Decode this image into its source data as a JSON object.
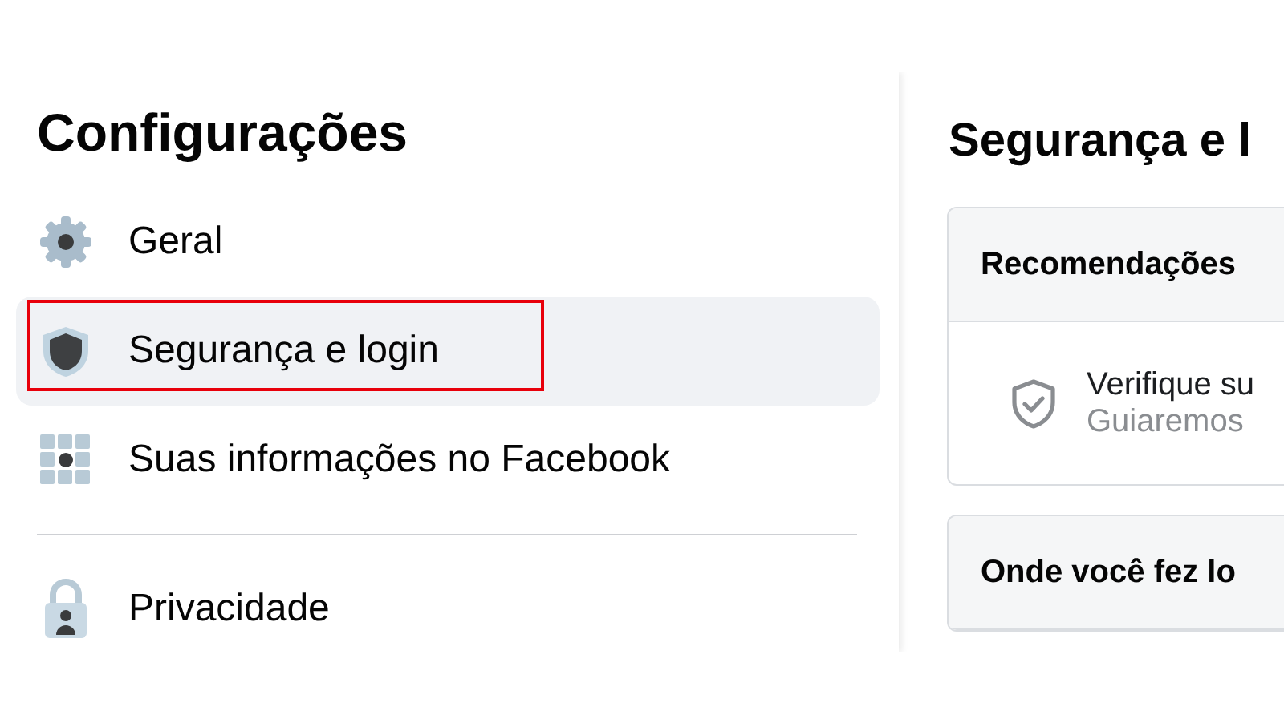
{
  "sidebar": {
    "title": "Configurações",
    "items": [
      {
        "label": "Geral",
        "selected": false,
        "outlined": false
      },
      {
        "label": "Segurança e login",
        "selected": true,
        "outlined": true
      },
      {
        "label": "Suas informações no Facebook",
        "selected": false,
        "outlined": false
      },
      {
        "kind": "divider"
      },
      {
        "label": "Privacidade",
        "selected": false,
        "outlined": false
      }
    ]
  },
  "main": {
    "title": "Segurança e l",
    "cards": [
      {
        "heading": "Recomendações",
        "rows": [
          {
            "title": "Verifique su",
            "subtitle": "Guiaremos"
          }
        ]
      },
      {
        "heading": "Onde você fez lo"
      }
    ]
  }
}
